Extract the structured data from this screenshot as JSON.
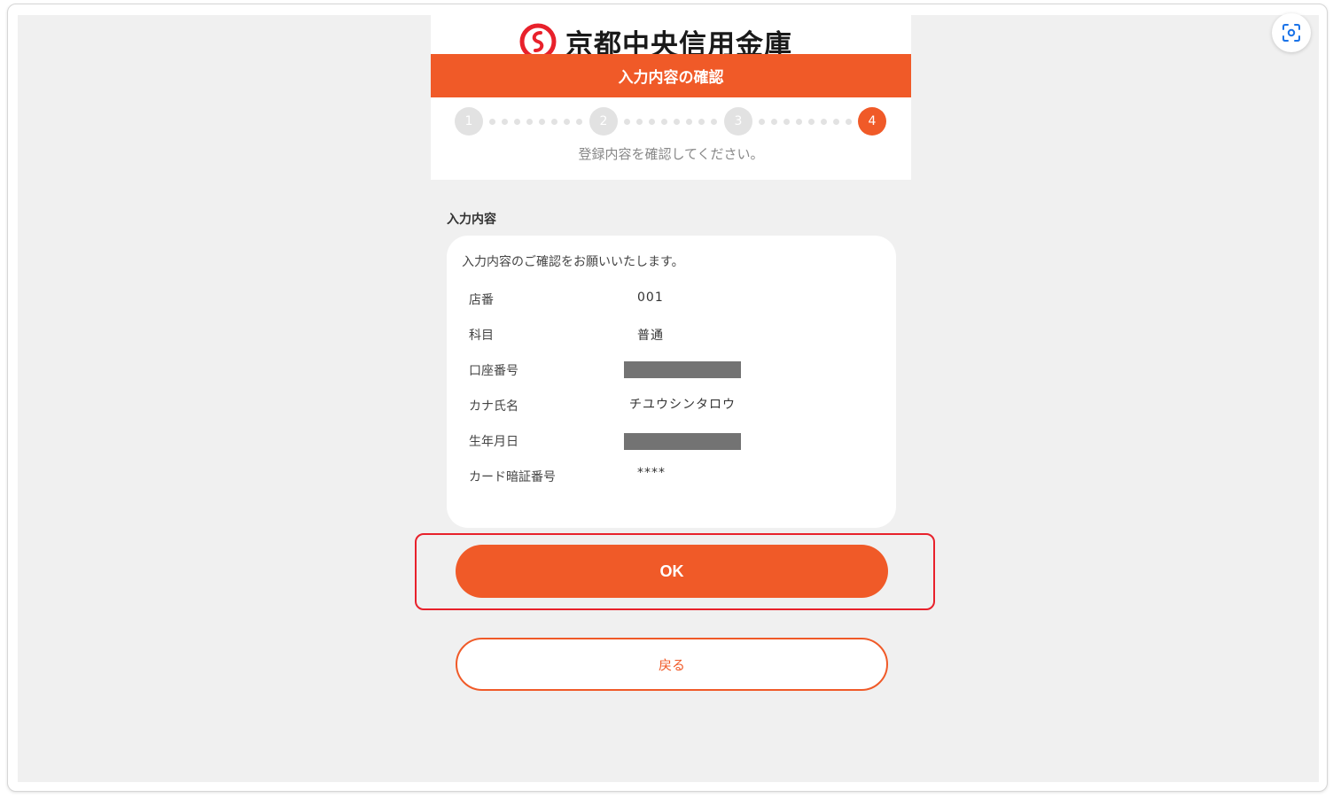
{
  "bank": {
    "name": "京都中央信用金庫"
  },
  "banner": {
    "title": "入力内容の確認"
  },
  "steps": {
    "labels": [
      "1",
      "2",
      "3",
      "4"
    ],
    "current": 4
  },
  "instruction": "登録内容を確認してください。",
  "section": {
    "label": "入力内容"
  },
  "confirmation": {
    "intro": "入力内容のご確認をお願いいたします。",
    "rows": [
      {
        "label": "店番",
        "value": "001"
      },
      {
        "label": "科目",
        "value": "普通"
      },
      {
        "label": "口座番号",
        "value": null
      },
      {
        "label": "カナ氏名",
        "value": "チユウシンタロウ"
      },
      {
        "label": "生年月日",
        "value": null
      },
      {
        "label": "カード暗証番号",
        "value": "****"
      }
    ]
  },
  "buttons": {
    "ok": "OK",
    "back": "戻る"
  },
  "colors": {
    "accent": "#f05a28",
    "highlight": "#e8212b",
    "background": "#f0f0f0",
    "redaction": "#737373"
  },
  "icons": {
    "logo": "bank-logo-icon",
    "screenshot_lens": "scan-lens-icon"
  }
}
